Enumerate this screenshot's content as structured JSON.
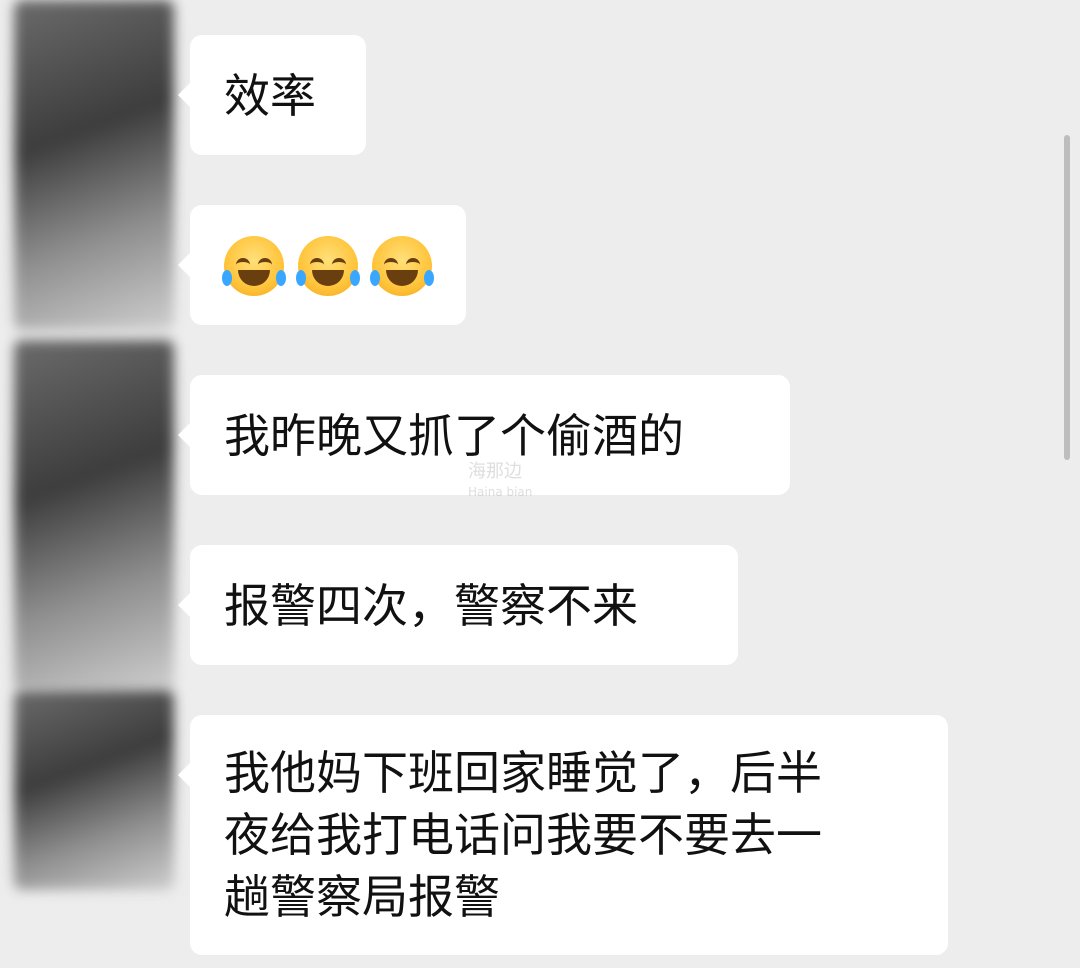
{
  "messages": [
    {
      "text": "效率"
    },
    {
      "emojis": [
        "joy-icon",
        "joy-icon",
        "joy-icon"
      ]
    },
    {
      "text": "我昨晚又抓了个偷酒的"
    },
    {
      "text": "报警四次，警察不来"
    },
    {
      "text": "我他妈下班回家睡觉了，后半\n夜给我打电话问我要不要去一\n趟警察局报警"
    }
  ],
  "watermark": {
    "main": "海那边",
    "sub": "Haina bian"
  }
}
